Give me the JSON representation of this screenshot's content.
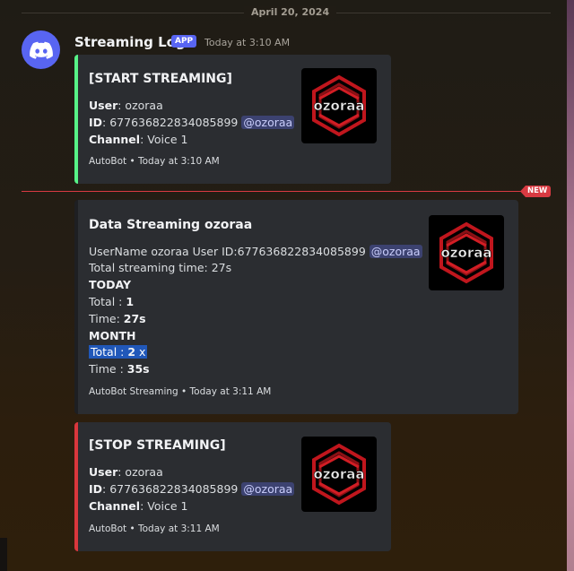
{
  "date_divider": "April 20, 2024",
  "header": {
    "username": "Streaming Log",
    "badge": "APP",
    "timestamp": "Today at 3:10 AM",
    "avatar_icon": "discord-icon"
  },
  "new_divider": {
    "label": "NEW",
    "color": "#d83a42"
  },
  "thumbnail": {
    "logo_text": "ozoraa"
  },
  "embeds": [
    {
      "accent": "#57f287",
      "title": "[START STREAMING]",
      "user_label": "User",
      "user_value": ": ozoraa",
      "id_label": "ID",
      "id_value": ": 677636822834085899",
      "mention": "@ozoraa",
      "channel_label": "Channel",
      "channel_value": ": Voice 1",
      "footer": "AutoBot • Today at 3:10 AM"
    },
    {
      "accent": "#1e1f22",
      "title": "Data Streaming ozoraa",
      "line1": "UserName ozoraa User ID:677636822834085899",
      "mention": "@ozoraa",
      "line2": "Total streaming time: 27s",
      "today_heading": "TODAY",
      "today_total_label": "Total : ",
      "today_total_value": "1",
      "today_time_label": "Time: ",
      "today_time_value": "27s",
      "month_heading": "MONTH",
      "month_total_label": "Total : ",
      "month_total_value": "2",
      "month_total_suffix": " x",
      "month_time_label": "Time : ",
      "month_time_value": "35s",
      "footer": "AutoBot Streaming • Today at 3:11 AM"
    },
    {
      "accent": "#da373c",
      "title": "[STOP STREAMING]",
      "user_label": "User",
      "user_value": ": ozoraa",
      "id_label": "ID",
      "id_value": ": 677636822834085899",
      "mention": "@ozoraa",
      "channel_label": "Channel",
      "channel_value": ": Voice 1",
      "footer": "AutoBot • Today at 3:11 AM"
    }
  ]
}
